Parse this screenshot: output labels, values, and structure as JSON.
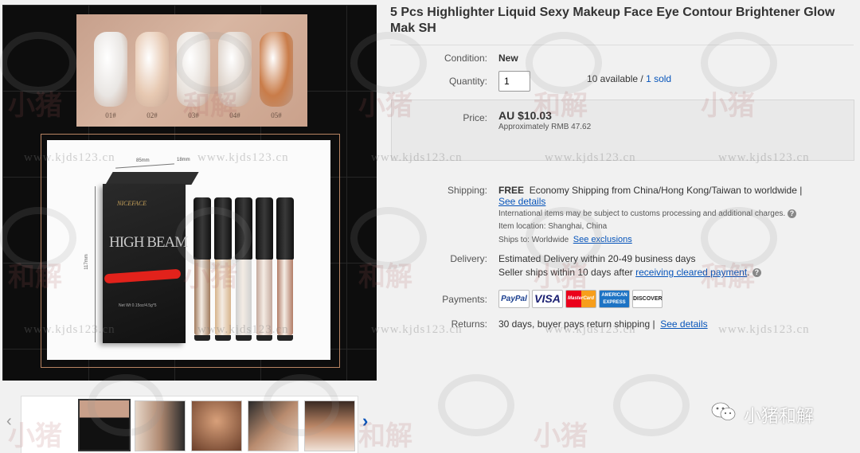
{
  "listing": {
    "title": "5 Pcs Highlighter Liquid Sexy Makeup Face Eye Contour Brightener Glow Mak SH"
  },
  "gallery": {
    "swatches": [
      {
        "label": "01#",
        "color": "#e9e6e3"
      },
      {
        "label": "02#",
        "color": "#e7c9b2"
      },
      {
        "label": "03#",
        "color": "#e8e2dc"
      },
      {
        "label": "04#",
        "color": "#ddd2c9"
      },
      {
        "label": "05#",
        "color": "#c97c49"
      }
    ],
    "box": {
      "brand": "NICEFACE",
      "title": "HIGH BEAM",
      "dim_width": "85mm",
      "dim_depth": "18mm",
      "dim_height": "117mm",
      "net_text": "Net Wt 0.15oz/4.5g*5"
    },
    "tube_colors": [
      "#a07a5c",
      "#d7b48c",
      "#cfd0d0",
      "#c4a89c",
      "#b27d67"
    ],
    "thumbnails": [
      {
        "name": "thumbnail-empty"
      },
      {
        "name": "thumbnail-swatches-box"
      },
      {
        "name": "thumbnail-tubes"
      },
      {
        "name": "thumbnail-model-face"
      },
      {
        "name": "thumbnail-before-after"
      },
      {
        "name": "thumbnail-model-portrait"
      }
    ],
    "prev_arrow": "‹",
    "next_arrow": "›"
  },
  "details": {
    "condition_label": "Condition:",
    "condition_value": "New",
    "quantity_label": "Quantity:",
    "quantity_value": "1",
    "available_text": "10 available /",
    "sold_link": "1 sold",
    "price_label": "Price:",
    "price_value": "AU $10.03",
    "price_approx": "Approximately RMB 47.62",
    "shipping_label": "Shipping:",
    "shipping_free": "FREE",
    "shipping_method": "Economy Shipping from China/Hong Kong/Taiwan to worldwide |",
    "shipping_details_link": "See details",
    "customs_note": "International items may be subject to customs processing and additional charges.",
    "item_location": "Item location:  Shanghai, China",
    "ships_to": "Ships to:  Worldwide",
    "exclusions_link": "See exclusions",
    "delivery_label": "Delivery:",
    "delivery_estimate": "Estimated Delivery within 20-49 business days",
    "seller_ships_text": "Seller ships within 10 days after",
    "cleared_payment_link": "receiving cleared payment",
    "cleared_payment_suffix": ".",
    "payments_label": "Payments:",
    "payment_methods": [
      "PayPal",
      "VISA",
      "MasterCard",
      "AMERICAN EXPRESS",
      "DISCOVER"
    ],
    "returns_label": "Returns:",
    "returns_text": "30 days, buyer pays return shipping |",
    "returns_details_link": "See details"
  },
  "watermark": {
    "site_text": "www.kjds123.cn",
    "overlay_chars": "小猪和解",
    "brand_text": "小猪和解"
  },
  "colors": {
    "link": "#0654ba",
    "page_bg": "#f1f1f1",
    "price_box_bg": "#e9e9e9"
  }
}
